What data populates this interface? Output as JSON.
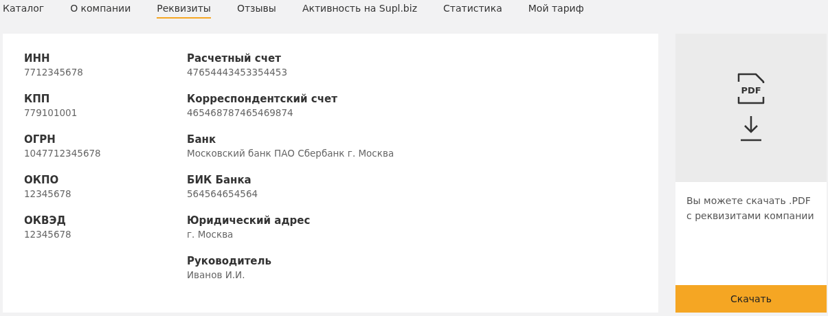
{
  "tabs": [
    {
      "label": "Каталог",
      "selected": false
    },
    {
      "label": "О компании",
      "selected": false
    },
    {
      "label": "Реквизиты",
      "selected": true
    },
    {
      "label": "Отзывы",
      "selected": false
    },
    {
      "label": "Активность на Supl.biz",
      "selected": false
    },
    {
      "label": "Статистика",
      "selected": false
    },
    {
      "label": "Мой тариф",
      "selected": false
    }
  ],
  "requisites": {
    "column_1": [
      {
        "label": "ИНН",
        "value": "7712345678"
      },
      {
        "label": "КПП",
        "value": "779101001"
      },
      {
        "label": "ОГРН",
        "value": "1047712345678"
      },
      {
        "label": "ОКПО",
        "value": "12345678"
      },
      {
        "label": "ОКВЭД",
        "value": "12345678"
      }
    ],
    "column_2": [
      {
        "label": "Расчетный счет",
        "value": "47654443453354453"
      },
      {
        "label": "Корреспондентский счет",
        "value": "465468787465469874"
      },
      {
        "label": "Банк",
        "value": "Московский банк ПАО Сбербанк г. Москва"
      },
      {
        "label": "БИК Банка",
        "value": "564564654564"
      },
      {
        "label": "Юридический адрес",
        "value": "г. Москва"
      },
      {
        "label": "Руководитель",
        "value": "Иванов И.И."
      }
    ]
  },
  "download": {
    "icon_label": "PDF",
    "text": "Вы можете скачать .PDF с реквизитами компании",
    "button": "Скачать"
  }
}
